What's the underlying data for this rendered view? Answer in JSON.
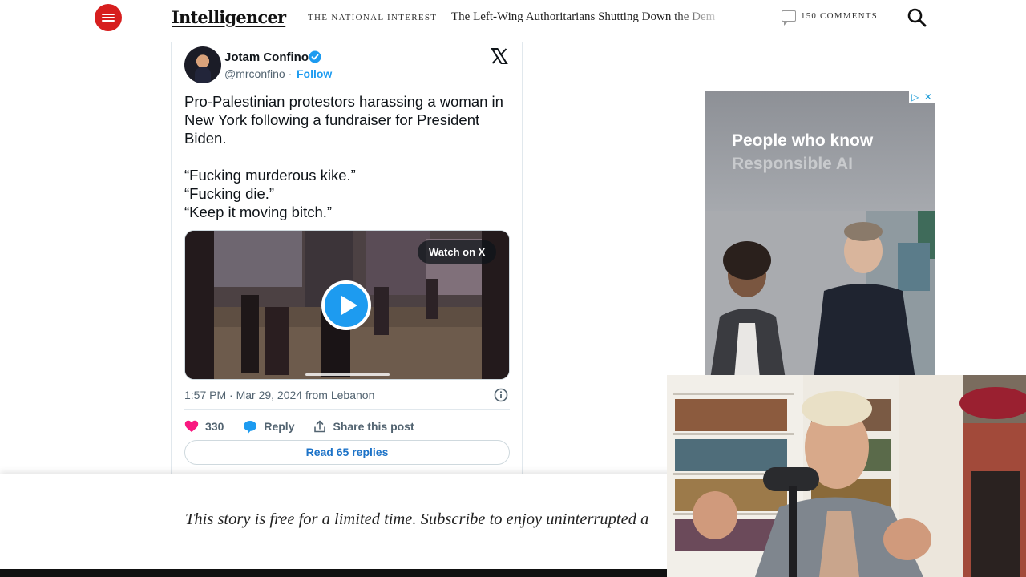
{
  "header": {
    "logo": "Intelligencer",
    "section": "The National Interest",
    "headline": "The Left-Wing Authoritarians Shutting Down the Dem",
    "comments": "150 Comments"
  },
  "tweet": {
    "author_name": "Jotam Confino",
    "handle": "@mrconfino",
    "handle_sep": " · ",
    "follow_label": "Follow",
    "text_lines": [
      "Pro-Palestinian protestors harassing a woman in New York following a fundraiser for President Biden.",
      "“Fucking murderous kike.”",
      "“Fucking die.”",
      "“Keep it moving bitch.”"
    ],
    "watch_label": "Watch on X",
    "timestamp": "1:57 PM · Mar 29, 2024 from Lebanon",
    "likes": "330",
    "reply_label": "Reply",
    "share_label": "Share this post",
    "read_replies_label": "Read 65 replies"
  },
  "ad": {
    "line1": "People who know",
    "line2": "Responsible AI"
  },
  "paywall": {
    "message": "This story is free for a limited time. Subscribe to enjoy uninterrupted a"
  },
  "colors": {
    "brand_red": "#d71e1e",
    "twitter_blue": "#1d9bf0",
    "heart": "#f91880"
  },
  "icons": [
    "menu-icon",
    "comment-icon",
    "search-icon",
    "verified-badge-icon",
    "x-logo-icon",
    "play-icon",
    "info-icon",
    "heart-icon",
    "reply-icon",
    "share-icon",
    "ad-choices-icon"
  ]
}
